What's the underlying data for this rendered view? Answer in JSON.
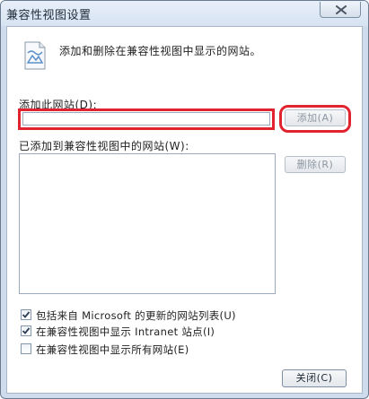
{
  "window": {
    "title": "兼容性视图设置",
    "close_icon": "close-icon"
  },
  "info": {
    "icon": "globe-page-icon",
    "description": "添加和删除在兼容性视图中显示的网站。"
  },
  "add_section": {
    "label": "添加此网站(D):",
    "input_value": "",
    "add_button": "添加(A)",
    "highlight_color": "#e0232e"
  },
  "list_section": {
    "label": "已添加到兼容性视图中的网站(W):",
    "items": [],
    "remove_button": "删除(R)"
  },
  "options": [
    {
      "label": "包括来自 Microsoft 的更新的网站列表(U)",
      "checked": true
    },
    {
      "label": "在兼容性视图中显示 Intranet 站点(I)",
      "checked": true
    },
    {
      "label": "在兼容性视图中显示所有网站(E)",
      "checked": false
    }
  ],
  "footer": {
    "close_button": "关闭(C)"
  }
}
